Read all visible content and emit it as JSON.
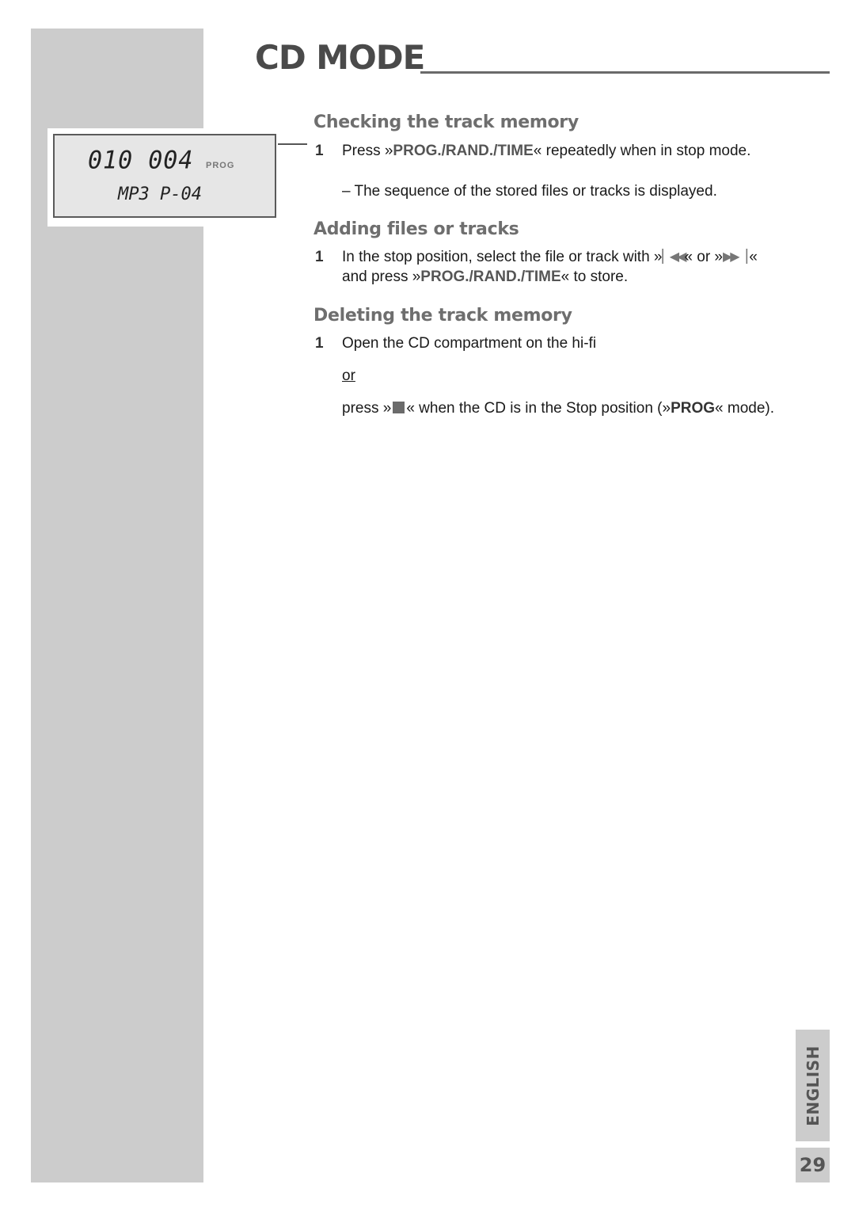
{
  "header": {
    "title": "CD MODE"
  },
  "lcd": {
    "line1": "010 004",
    "indicator": "PROG",
    "line2": "MP3 P-04"
  },
  "sections": [
    {
      "heading": "Checking the track memory",
      "steps": [
        {
          "number": "1",
          "parts": {
            "pre": "Press »",
            "key": "PROG./RAND./TIME",
            "post": "« repeatedly when in stop mode."
          },
          "result": "– The sequence of the stored files or tracks is displayed."
        }
      ]
    },
    {
      "heading": "Adding files or tracks",
      "steps": [
        {
          "number": "1",
          "parts": {
            "pre": "In the stop position, select the file or track with »",
            "icon_prev": "⏮",
            "mid": "« or »",
            "icon_next": "⏭",
            "mid2": "« and press »",
            "key": "PROG./RAND./TIME",
            "post": "« to store."
          }
        }
      ]
    },
    {
      "heading": "Deleting the track memory",
      "steps": [
        {
          "number": "1",
          "line1": "Open the CD compartment on the hi-fi",
          "or": "or",
          "parts": {
            "pre": "press »",
            "mid": "« when the CD is in the Stop position (»",
            "key": "PROG",
            "post": "« mode)."
          }
        }
      ]
    }
  ],
  "icons": {
    "skip_back": "skip-back-icon",
    "skip_forward": "skip-forward-icon",
    "stop": "stop-icon"
  },
  "footer": {
    "language": "ENGLISH",
    "page_number": "29"
  }
}
